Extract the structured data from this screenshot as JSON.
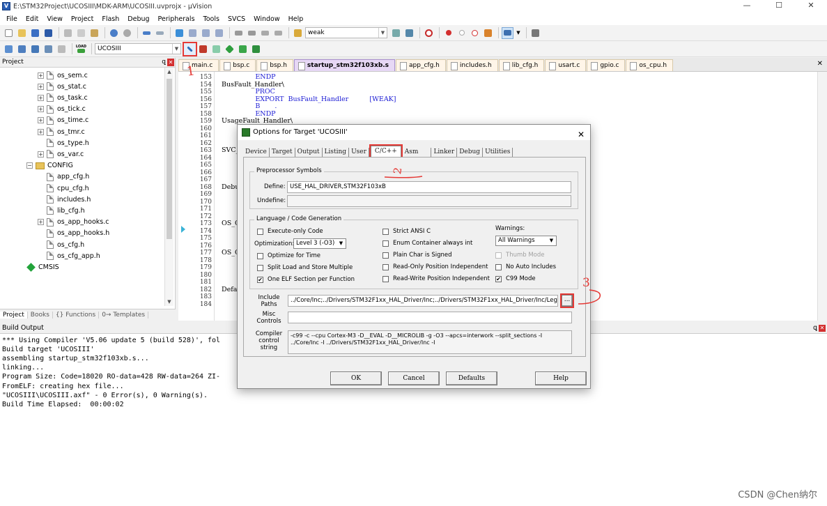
{
  "window": {
    "title": "E:\\STM32Project\\UCOSIII\\MDK-ARM\\UCOSIII.uvprojx - µVision",
    "min": "—",
    "max": "☐",
    "close": "✕"
  },
  "menu": [
    "File",
    "Edit",
    "View",
    "Project",
    "Flash",
    "Debug",
    "Peripherals",
    "Tools",
    "SVCS",
    "Window",
    "Help"
  ],
  "toolbar1": {
    "search_combo": "weak"
  },
  "toolbar2": {
    "target_combo": "UCOSIII",
    "load_label": "LOAD"
  },
  "project_panel": {
    "title": "Project",
    "pin": "ꝗ",
    "close": "✕",
    "items": [
      {
        "label": "os_sem.c",
        "kind": "file",
        "expand": "+"
      },
      {
        "label": "os_stat.c",
        "kind": "file",
        "expand": "+"
      },
      {
        "label": "os_task.c",
        "kind": "file",
        "expand": "+"
      },
      {
        "label": "os_tick.c",
        "kind": "file",
        "expand": "+"
      },
      {
        "label": "os_time.c",
        "kind": "file",
        "expand": "+"
      },
      {
        "label": "os_tmr.c",
        "kind": "file",
        "expand": "+"
      },
      {
        "label": "os_type.h",
        "kind": "file",
        "expand": ""
      },
      {
        "label": "os_var.c",
        "kind": "file",
        "expand": "+"
      },
      {
        "label": "CONFIG",
        "kind": "folder",
        "expand": "−"
      },
      {
        "label": "app_cfg.h",
        "kind": "file",
        "expand": ""
      },
      {
        "label": "cpu_cfg.h",
        "kind": "file",
        "expand": ""
      },
      {
        "label": "includes.h",
        "kind": "file",
        "expand": ""
      },
      {
        "label": "lib_cfg.h",
        "kind": "file",
        "expand": ""
      },
      {
        "label": "os_app_hooks.c",
        "kind": "file",
        "expand": "+"
      },
      {
        "label": "os_app_hooks.h",
        "kind": "file",
        "expand": ""
      },
      {
        "label": "os_cfg.h",
        "kind": "file",
        "expand": ""
      },
      {
        "label": "os_cfg_app.h",
        "kind": "file",
        "expand": ""
      },
      {
        "label": "CMSIS",
        "kind": "component",
        "expand": ""
      }
    ],
    "tabs": [
      "Project",
      "Books",
      "{} Functions",
      "0→ Templates"
    ]
  },
  "file_tabs": [
    {
      "label": "main.c",
      "active": false
    },
    {
      "label": "bsp.c",
      "active": false
    },
    {
      "label": "bsp.h",
      "active": false
    },
    {
      "label": "startup_stm32f103xb.s",
      "active": true
    },
    {
      "label": "app_cfg.h",
      "active": false
    },
    {
      "label": "includes.h",
      "active": false
    },
    {
      "label": "lib_cfg.h",
      "active": false
    },
    {
      "label": "usart.c",
      "active": false
    },
    {
      "label": "gpio.c",
      "active": false
    },
    {
      "label": "os_cpu.h",
      "active": false
    }
  ],
  "editor_close": "✕",
  "code": [
    {
      "n": "153",
      "t": "                ENDP",
      "kw": true
    },
    {
      "n": "154",
      "t": "BusFault_Handler\\",
      "kw": false
    },
    {
      "n": "155",
      "t": "                PROC",
      "kw": true
    },
    {
      "n": "156",
      "t": "                EXPORT  BusFault_Handler          [WEAK]",
      "kw": true
    },
    {
      "n": "157",
      "t": "                B       .",
      "kw": true
    },
    {
      "n": "158",
      "t": "                ENDP",
      "kw": true
    },
    {
      "n": "159",
      "t": "UsageFault_Handler\\",
      "kw": false
    },
    {
      "n": "160",
      "t": "",
      "kw": false
    },
    {
      "n": "161",
      "t": "",
      "kw": false
    },
    {
      "n": "162",
      "t": "",
      "kw": false
    },
    {
      "n": "163",
      "t": "SVC_",
      "kw": false
    },
    {
      "n": "164",
      "t": "",
      "kw": false
    },
    {
      "n": "165",
      "t": "",
      "kw": false
    },
    {
      "n": "166",
      "t": "",
      "kw": false
    },
    {
      "n": "167",
      "t": "",
      "kw": false
    },
    {
      "n": "168",
      "t": "Debu",
      "kw": false
    },
    {
      "n": "169",
      "t": "",
      "kw": false
    },
    {
      "n": "170",
      "t": "",
      "kw": false
    },
    {
      "n": "171",
      "t": "",
      "kw": false
    },
    {
      "n": "172",
      "t": "",
      "kw": false
    },
    {
      "n": "173",
      "t": "OS_C",
      "kw": false
    },
    {
      "n": "174",
      "t": "",
      "kw": false
    },
    {
      "n": "175",
      "t": "",
      "kw": false
    },
    {
      "n": "176",
      "t": "",
      "kw": false
    },
    {
      "n": "177",
      "t": "OS_C",
      "kw": false
    },
    {
      "n": "178",
      "t": "",
      "kw": false
    },
    {
      "n": "179",
      "t": "",
      "kw": false
    },
    {
      "n": "180",
      "t": "",
      "kw": false
    },
    {
      "n": "181",
      "t": "",
      "kw": false
    },
    {
      "n": "182",
      "t": "Defa",
      "kw": false
    },
    {
      "n": "183",
      "t": "",
      "kw": false
    },
    {
      "n": "184",
      "t": "",
      "kw": false
    }
  ],
  "build": {
    "title": "Build Output",
    "pin": "ꝗ",
    "close": "✕",
    "lines": [
      "*** Using Compiler 'V5.06 update 5 (build 528)', fol",
      "Build target 'UCOSIII'",
      "assembling startup_stm32f103xb.s...",
      "linking...",
      "Program Size: Code=18020 RO-data=428 RW-data=264 ZI-",
      "FromELF: creating hex file...",
      "\"UCOSIII\\UCOSIII.axf\" - 0 Error(s), 0 Warning(s).",
      "Build Time Elapsed:  00:00:02"
    ]
  },
  "dialog": {
    "title": "Options for Target 'UCOSIII'",
    "close": "✕",
    "tabs": [
      "Device",
      "Target",
      "Output",
      "Listing",
      "User",
      "C/C++",
      "Asm",
      "Linker",
      "Debug",
      "Utilities"
    ],
    "active_tab": "C/C++",
    "preproc": {
      "title": "Preprocessor Symbols",
      "define_label": "Define:",
      "define_value": "USE_HAL_DRIVER,STM32F103xB",
      "undefine_label": "Undefine:",
      "undefine_value": ""
    },
    "lang": {
      "title": "Language / Code Generation",
      "execute_only": {
        "label": "Execute-only Code",
        "checked": false
      },
      "optimization_label": "Optimization:",
      "optimization_value": "Level 3 (-O3)",
      "optimize_time": {
        "label": "Optimize for Time",
        "checked": false
      },
      "split_load": {
        "label": "Split Load and Store Multiple",
        "checked": false
      },
      "one_elf": {
        "label": "One ELF Section per Function",
        "checked": true
      },
      "strict_ansi": {
        "label": "Strict ANSI C",
        "checked": false
      },
      "enum_container": {
        "label": "Enum Container always int",
        "checked": false
      },
      "plain_char": {
        "label": "Plain Char is Signed",
        "checked": false
      },
      "ro_pi": {
        "label": "Read-Only Position Independent",
        "checked": false
      },
      "rw_pi": {
        "label": "Read-Write Position Independent",
        "checked": false
      },
      "warnings_label": "Warnings:",
      "warnings_value": "All Warnings",
      "thumb_mode": {
        "label": "Thumb Mode",
        "checked": false
      },
      "no_auto_includes": {
        "label": "No Auto Includes",
        "checked": false
      },
      "c99": {
        "label": "C99 Mode",
        "checked": true
      }
    },
    "include_paths_label": "Include\nPaths",
    "include_paths_value": "../Core/Inc;../Drivers/STM32F1xx_HAL_Driver/Inc;../Drivers/STM32F1xx_HAL_Driver/Inc/Legacy",
    "browse_label": "...",
    "misc_label": "Misc\nControls",
    "misc_value": "",
    "compiler_label": "Compiler\ncontrol\nstring",
    "compiler_value": "-c99 -c --cpu Cortex-M3 -D__EVAL -D__MICROLIB -g -O3 --apcs=interwork --split_sections -I\n../Core/Inc -I ../Drivers/STM32F1xx_HAL_Driver/Inc -I",
    "buttons": {
      "ok": "OK",
      "cancel": "Cancel",
      "defaults": "Defaults",
      "help": "Help"
    }
  },
  "annotations": {
    "one": "1",
    "two": "2",
    "three": "3"
  },
  "watermark": "CSDN @Chen纳尔",
  "colors": {
    "highlight_red": "#e53935",
    "active_tab": "#e7d8f5",
    "keyword": "#1a1ad4"
  }
}
